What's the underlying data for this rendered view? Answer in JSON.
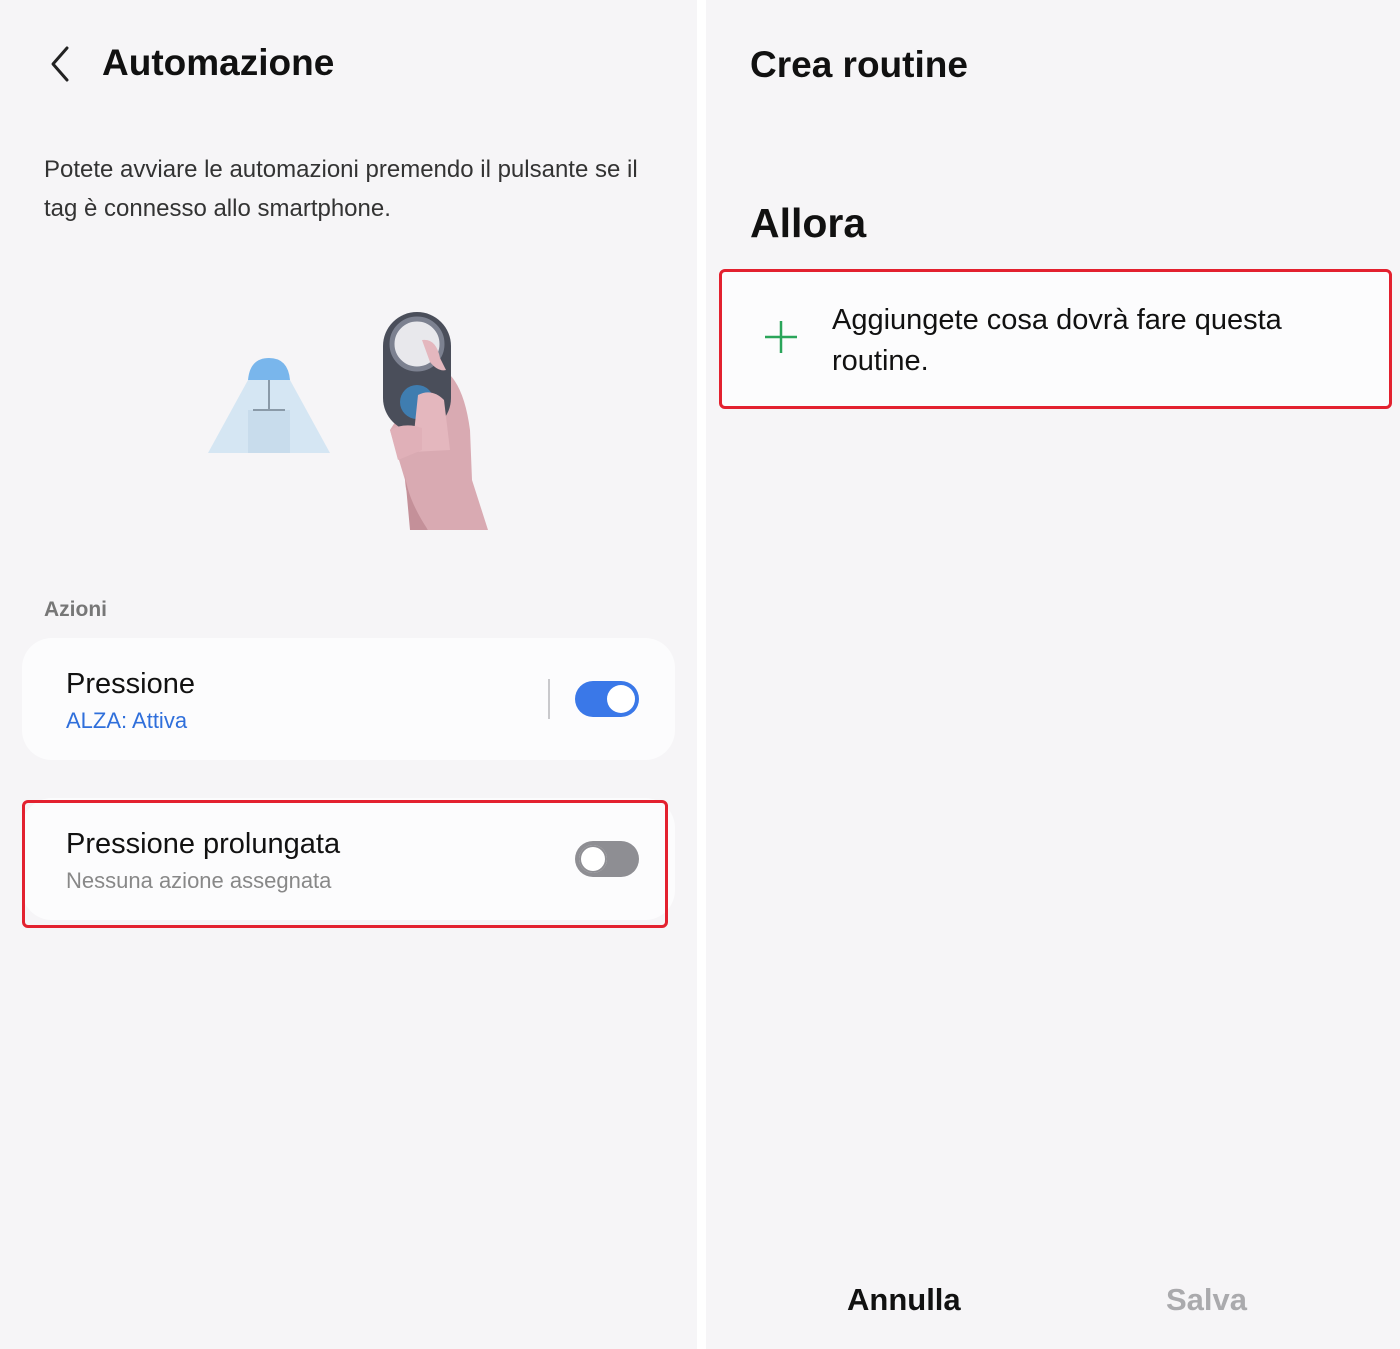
{
  "left": {
    "title": "Automazione",
    "description": "Potete avviare le automazioni premendo il pulsante se il tag è connesso allo smartphone.",
    "section_label": "Azioni",
    "actions": [
      {
        "title": "Pressione",
        "subtitle": "ALZA: Attiva",
        "enabled": true
      },
      {
        "title": "Pressione prolungata",
        "subtitle": "Nessuna azione assegnata",
        "enabled": false
      }
    ]
  },
  "right": {
    "title": "Crea routine",
    "section_heading": "Allora",
    "add_action_text": "Aggiungete cosa dovrà fare questa routine.",
    "buttons": {
      "cancel": "Annulla",
      "save": "Salva"
    }
  },
  "colors": {
    "accent": "#3a78e8",
    "highlight": "#e3212f",
    "plus": "#2aa55a",
    "background": "#f6f5f7"
  },
  "icons": {
    "back": "chevron-left-icon",
    "add": "plus-icon"
  }
}
